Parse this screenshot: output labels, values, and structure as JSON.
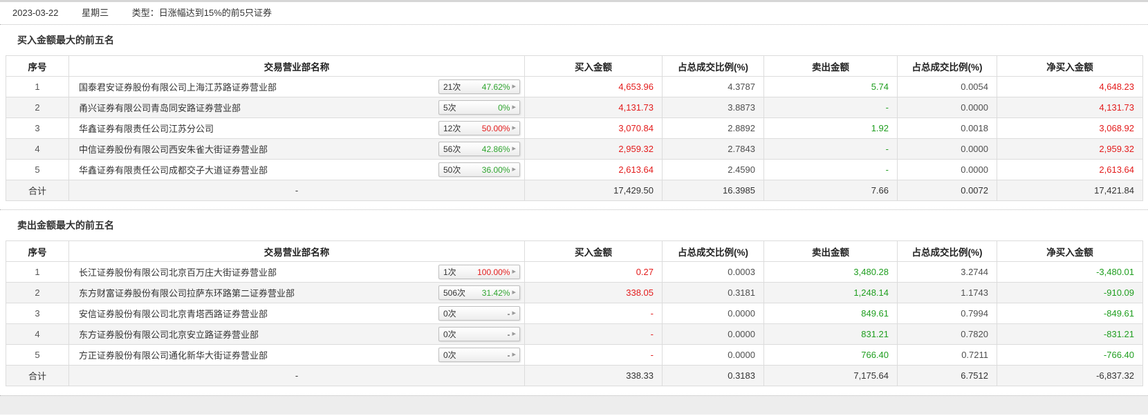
{
  "info_bar": {
    "date": "2023-03-22",
    "weekday": "星期三",
    "type_text": "类型：日涨幅达到15%的前5只证券"
  },
  "icons": {
    "badge_arrow": "▸"
  },
  "colors": {
    "up_red": "#e31b1b",
    "down_green": "#1f9e1f",
    "neutral_gray": "#4f4f4f"
  },
  "table_headers": {
    "index": "序号",
    "broker": "交易营业部名称",
    "buy": "买入金额",
    "buy_ratio": "占总成交比例(%)",
    "sell": "卖出金额",
    "sell_ratio": "占总成交比例(%)",
    "net": "净买入金额"
  },
  "buy_section": {
    "title": "买入金额最大的前五名",
    "rows": [
      {
        "index": "1",
        "name": "国泰君安证券股份有限公司上海江苏路证券营业部",
        "badge_count": "21次",
        "badge_pct": "47.62%",
        "badge_tone": "green",
        "buy": "4,653.96",
        "buy_ratio": "4.3787",
        "sell": "5.74",
        "sell_ratio": "0.0054",
        "net": "4,648.23"
      },
      {
        "index": "2",
        "name": "甬兴证券有限公司青岛同安路证券营业部",
        "badge_count": "5次",
        "badge_pct": "0%",
        "badge_tone": "green",
        "buy": "4,131.73",
        "buy_ratio": "3.8873",
        "sell": "-",
        "sell_ratio": "0.0000",
        "net": "4,131.73"
      },
      {
        "index": "3",
        "name": "华鑫证券有限责任公司江苏分公司",
        "badge_count": "12次",
        "badge_pct": "50.00%",
        "badge_tone": "red",
        "buy": "3,070.84",
        "buy_ratio": "2.8892",
        "sell": "1.92",
        "sell_ratio": "0.0018",
        "net": "3,068.92"
      },
      {
        "index": "4",
        "name": "中信证券股份有限公司西安朱雀大街证券营业部",
        "badge_count": "56次",
        "badge_pct": "42.86%",
        "badge_tone": "green",
        "buy": "2,959.32",
        "buy_ratio": "2.7843",
        "sell": "-",
        "sell_ratio": "0.0000",
        "net": "2,959.32"
      },
      {
        "index": "5",
        "name": "华鑫证券有限责任公司成都交子大道证券营业部",
        "badge_count": "50次",
        "badge_pct": "36.00%",
        "badge_tone": "green",
        "buy": "2,613.64",
        "buy_ratio": "2.4590",
        "sell": "-",
        "sell_ratio": "0.0000",
        "net": "2,613.64"
      }
    ],
    "total": {
      "label": "合计",
      "name": "-",
      "buy": "17,429.50",
      "buy_ratio": "16.3985",
      "sell": "7.66",
      "sell_ratio": "0.0072",
      "net": "17,421.84"
    }
  },
  "sell_section": {
    "title": "卖出金额最大的前五名",
    "rows": [
      {
        "index": "1",
        "name": "长江证券股份有限公司北京百万庄大街证券营业部",
        "badge_count": "1次",
        "badge_pct": "100.00%",
        "badge_tone": "red",
        "buy": "0.27",
        "buy_ratio": "0.0003",
        "sell": "3,480.28",
        "sell_ratio": "3.2744",
        "net": "-3,480.01"
      },
      {
        "index": "2",
        "name": "东方财富证券股份有限公司拉萨东环路第二证券营业部",
        "badge_count": "506次",
        "badge_pct": "31.42%",
        "badge_tone": "green",
        "buy": "338.05",
        "buy_ratio": "0.3181",
        "sell": "1,248.14",
        "sell_ratio": "1.1743",
        "net": "-910.09"
      },
      {
        "index": "3",
        "name": "安信证券股份有限公司北京青塔西路证券营业部",
        "badge_count": "0次",
        "badge_pct": "-",
        "badge_tone": "dash",
        "buy": "-",
        "buy_ratio": "0.0000",
        "sell": "849.61",
        "sell_ratio": "0.7994",
        "net": "-849.61"
      },
      {
        "index": "4",
        "name": "东方证券股份有限公司北京安立路证券营业部",
        "badge_count": "0次",
        "badge_pct": "-",
        "badge_tone": "dash",
        "buy": "-",
        "buy_ratio": "0.0000",
        "sell": "831.21",
        "sell_ratio": "0.7820",
        "net": "-831.21"
      },
      {
        "index": "5",
        "name": "方正证券股份有限公司通化新华大街证券营业部",
        "badge_count": "0次",
        "badge_pct": "-",
        "badge_tone": "dash",
        "buy": "-",
        "buy_ratio": "0.0000",
        "sell": "766.40",
        "sell_ratio": "0.7211",
        "net": "-766.40"
      }
    ],
    "total": {
      "label": "合计",
      "name": "-",
      "buy": "338.33",
      "buy_ratio": "0.3183",
      "sell": "7,175.64",
      "sell_ratio": "6.7512",
      "net": "-6,837.32"
    }
  }
}
